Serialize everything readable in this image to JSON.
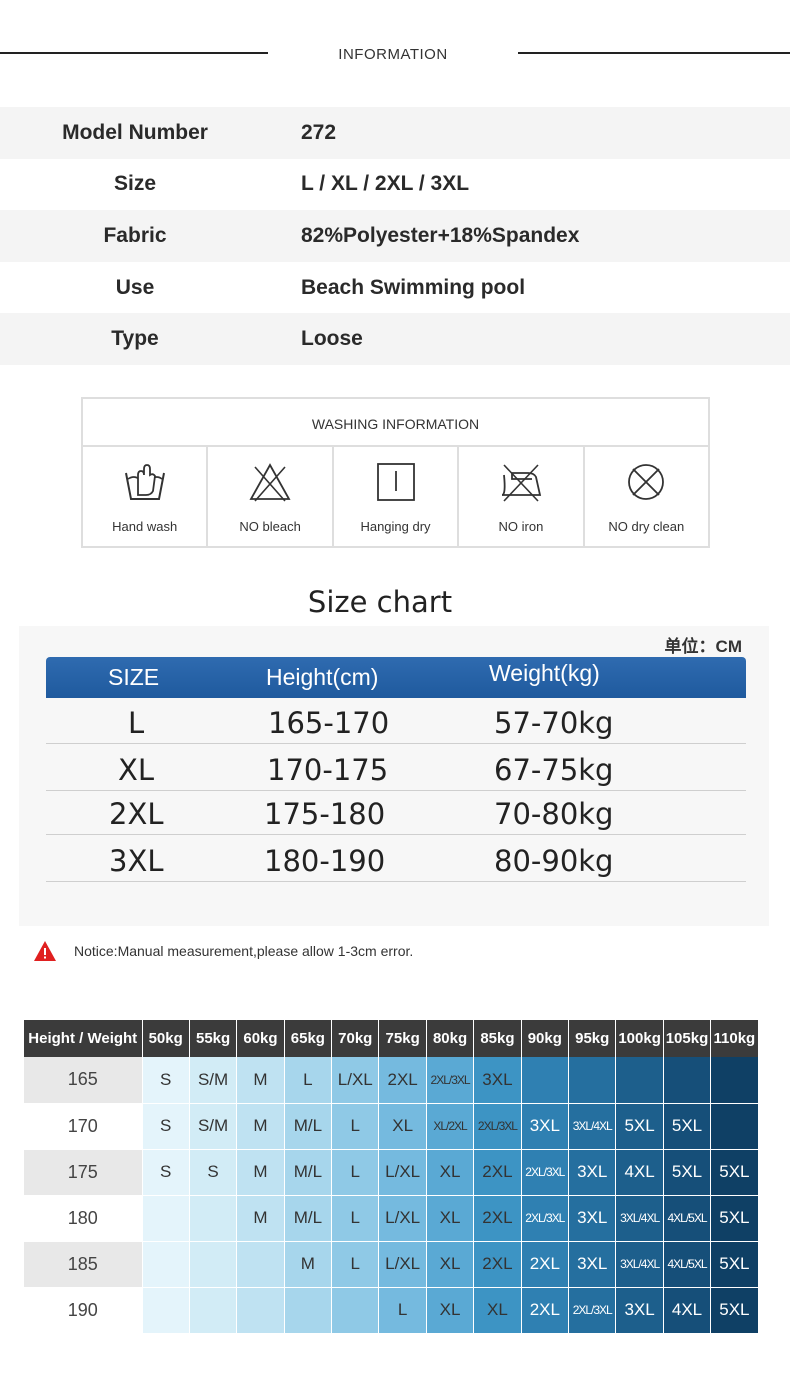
{
  "information": {
    "title": "INFORMATION"
  },
  "spec": [
    {
      "label": "Model Number",
      "value": "272"
    },
    {
      "label": "Size",
      "value": "L / XL / 2XL / 3XL"
    },
    {
      "label": "Fabric",
      "value": "82%Polyester+18%Spandex"
    },
    {
      "label": "Use",
      "value": "Beach Swimming pool"
    },
    {
      "label": "Type",
      "value": "Loose"
    }
  ],
  "washing": {
    "title": "WASHING INFORMATION",
    "items": [
      {
        "label": "Hand wash",
        "icon": "hand-wash-icon"
      },
      {
        "label": "NO bleach",
        "icon": "no-bleach-icon"
      },
      {
        "label": "Hanging dry",
        "icon": "hanging-dry-icon"
      },
      {
        "label": "NO iron",
        "icon": "no-iron-icon"
      },
      {
        "label": "NO dry clean",
        "icon": "no-dry-clean-icon"
      }
    ]
  },
  "size_chart": {
    "title": "Size chart",
    "unit": "单位：CM",
    "header_color": "#2a65aa",
    "headers": [
      "SIZE",
      "Height(cm)",
      "Weight(kg)"
    ],
    "rows": [
      [
        "L",
        "165-170",
        "57-70kg"
      ],
      [
        "XL",
        "170-175",
        "67-75kg"
      ],
      [
        "2XL",
        "175-180",
        "70-80kg"
      ],
      [
        "3XL",
        "180-190",
        "80-90kg"
      ]
    ]
  },
  "notice": {
    "text": "Notice:Manual measurement,please allow 1-3cm error.",
    "icon": "warning-icon",
    "color": "#e02020"
  },
  "grid": {
    "corner": "Height / Weight",
    "weights": [
      "50kg",
      "55kg",
      "60kg",
      "65kg",
      "70kg",
      "75kg",
      "80kg",
      "85kg",
      "90kg",
      "95kg",
      "100kg",
      "105kg",
      "110kg"
    ],
    "palette": [
      "#e4f4fb",
      "#d2ecf6",
      "#bfe2f2",
      "#a7d6ec",
      "#8fc9e6",
      "#75badf",
      "#5aa9d4",
      "#3d94c4",
      "#2f80b2",
      "#256f9f",
      "#1d5f8c",
      "#164f79",
      "#0f4065"
    ],
    "rows": [
      {
        "height": "165",
        "cells": [
          "S",
          "S/M",
          "M",
          "L",
          "L/XL",
          "2XL",
          "2XL/3XL",
          "3XL",
          "",
          "",
          "",
          "",
          ""
        ]
      },
      {
        "height": "170",
        "cells": [
          "S",
          "S/M",
          "M",
          "M/L",
          "L",
          "XL",
          "XL/2XL",
          "2XL/3XL",
          "3XL",
          "3XL/4XL",
          "5XL",
          "5XL",
          ""
        ]
      },
      {
        "height": "175",
        "cells": [
          "S",
          "S",
          "M",
          "M/L",
          "L",
          "L/XL",
          "XL",
          "2XL",
          "2XL/3XL",
          "3XL",
          "4XL",
          "5XL",
          "5XL"
        ]
      },
      {
        "height": "180",
        "cells": [
          "",
          "",
          "M",
          "M/L",
          "L",
          "L/XL",
          "XL",
          "2XL",
          "2XL/3XL",
          "3XL",
          "3XL/4XL",
          "4XL/5XL",
          "5XL"
        ]
      },
      {
        "height": "185",
        "cells": [
          "",
          "",
          "",
          "M",
          "L",
          "L/XL",
          "XL",
          "2XL",
          "2XL",
          "3XL",
          "3XL/4XL",
          "4XL/5XL",
          "5XL"
        ]
      },
      {
        "height": "190",
        "cells": [
          "",
          "",
          "",
          "",
          "",
          "L",
          "XL",
          "XL",
          "2XL",
          "2XL/3XL",
          "3XL",
          "4XL",
          "5XL"
        ]
      }
    ]
  }
}
